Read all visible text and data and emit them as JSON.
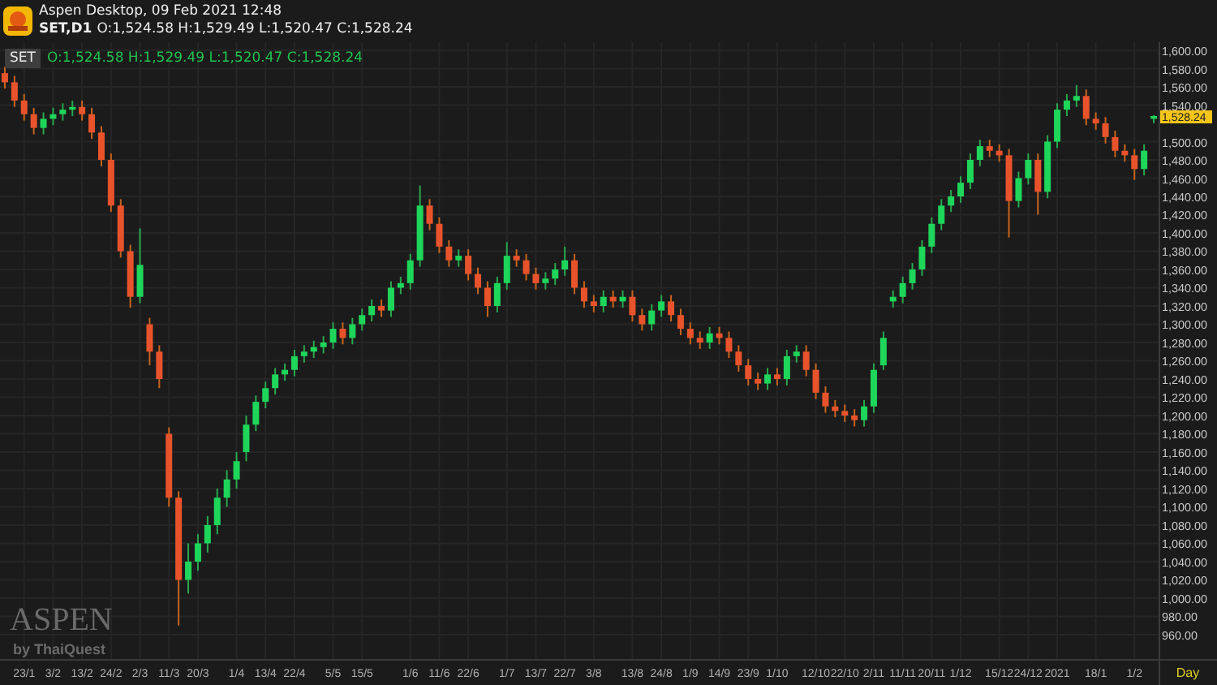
{
  "window": {
    "title": "Aspen Desktop, 09 Feb 2021 12:48",
    "symbol": "SET,D1",
    "ohlc": "O:1,524.58 H:1,529.49 L:1,520.47 C:1,528.24"
  },
  "chart": {
    "symbol_badge": "SET",
    "ohlc_legend": "O:1,524.58 H:1,529.49 L:1,520.47 C:1,528.24",
    "last_price_label": "1,528.24",
    "timeframe": "Day",
    "branding": {
      "name": "ASPEN",
      "byline": "by ThaiQuest"
    },
    "chart_data": {
      "type": "candlestick",
      "categories": [
        null,
        null,
        "23/1",
        null,
        null,
        "3/2",
        null,
        null,
        "13/2",
        null,
        null,
        "24/2",
        null,
        null,
        "2/3",
        null,
        null,
        "11/3",
        null,
        null,
        "20/3",
        null,
        null,
        null,
        "1/4",
        null,
        null,
        "13/4",
        null,
        null,
        "22/4",
        null,
        null,
        null,
        "5/5",
        null,
        null,
        "15/5",
        null,
        null,
        null,
        null,
        "1/6",
        null,
        null,
        "11/6",
        null,
        null,
        "22/6",
        null,
        null,
        null,
        "1/7",
        null,
        null,
        "13/7",
        null,
        null,
        "22/7",
        null,
        null,
        "3/8",
        null,
        null,
        null,
        "13/8",
        null,
        null,
        "24/8",
        null,
        null,
        "1/9",
        null,
        null,
        "14/9",
        null,
        null,
        "23/9",
        null,
        null,
        "1/10",
        null,
        null,
        null,
        "12/10",
        null,
        null,
        "22/10",
        null,
        null,
        "2/11",
        null,
        null,
        "11/11",
        null,
        null,
        "20/11",
        null,
        null,
        "1/12",
        null,
        null,
        null,
        "15/12",
        null,
        null,
        "24/12",
        null,
        null,
        "2021",
        null,
        null,
        null,
        "18/1",
        null,
        null,
        null,
        "1/2",
        null,
        null
      ],
      "ohlc": [
        [
          1575,
          1582,
          1558,
          1565
        ],
        [
          1565,
          1572,
          1538,
          1545
        ],
        [
          1545,
          1552,
          1523,
          1530
        ],
        [
          1530,
          1537,
          1508,
          1515
        ],
        [
          1515,
          1532,
          1508,
          1525
        ],
        [
          1525,
          1537,
          1518,
          1530
        ],
        [
          1530,
          1542,
          1523,
          1535
        ],
        [
          1535,
          1545,
          1528,
          1538
        ],
        [
          1538,
          1545,
          1523,
          1530
        ],
        [
          1530,
          1537,
          1503,
          1510
        ],
        [
          1510,
          1517,
          1473,
          1480
        ],
        [
          1480,
          1487,
          1423,
          1430
        ],
        [
          1430,
          1437,
          1373,
          1380
        ],
        [
          1380,
          1387,
          1318,
          1330
        ],
        [
          1330,
          1405,
          1323,
          1365
        ],
        [
          1300,
          1307,
          1255,
          1270
        ],
        [
          1270,
          1277,
          1230,
          1240
        ],
        [
          1180,
          1187,
          1100,
          1110
        ],
        [
          1110,
          1117,
          970,
          1020
        ],
        [
          1020,
          1060,
          1005,
          1040
        ],
        [
          1040,
          1070,
          1030,
          1060
        ],
        [
          1060,
          1090,
          1050,
          1080
        ],
        [
          1080,
          1120,
          1070,
          1110
        ],
        [
          1110,
          1140,
          1100,
          1130
        ],
        [
          1130,
          1160,
          1120,
          1150
        ],
        [
          1160,
          1200,
          1150,
          1190
        ],
        [
          1190,
          1222,
          1183,
          1215
        ],
        [
          1215,
          1237,
          1208,
          1230
        ],
        [
          1230,
          1252,
          1223,
          1245
        ],
        [
          1245,
          1257,
          1238,
          1250
        ],
        [
          1250,
          1272,
          1243,
          1265
        ],
        [
          1265,
          1277,
          1258,
          1270
        ],
        [
          1270,
          1282,
          1263,
          1275
        ],
        [
          1275,
          1287,
          1268,
          1280
        ],
        [
          1280,
          1302,
          1273,
          1295
        ],
        [
          1295,
          1302,
          1278,
          1285
        ],
        [
          1285,
          1307,
          1278,
          1300
        ],
        [
          1300,
          1317,
          1293,
          1310
        ],
        [
          1310,
          1327,
          1303,
          1320
        ],
        [
          1320,
          1327,
          1308,
          1315
        ],
        [
          1315,
          1347,
          1308,
          1340
        ],
        [
          1340,
          1352,
          1333,
          1345
        ],
        [
          1345,
          1377,
          1338,
          1370
        ],
        [
          1370,
          1452,
          1363,
          1430
        ],
        [
          1430,
          1437,
          1403,
          1410
        ],
        [
          1410,
          1417,
          1378,
          1385
        ],
        [
          1385,
          1392,
          1363,
          1370
        ],
        [
          1370,
          1382,
          1363,
          1375
        ],
        [
          1375,
          1382,
          1348,
          1355
        ],
        [
          1355,
          1362,
          1333,
          1340
        ],
        [
          1340,
          1347,
          1308,
          1320
        ],
        [
          1320,
          1352,
          1313,
          1345
        ],
        [
          1345,
          1390,
          1338,
          1375
        ],
        [
          1375,
          1382,
          1363,
          1370
        ],
        [
          1370,
          1377,
          1348,
          1355
        ],
        [
          1355,
          1362,
          1338,
          1345
        ],
        [
          1345,
          1357,
          1338,
          1350
        ],
        [
          1350,
          1367,
          1343,
          1360
        ],
        [
          1360,
          1385,
          1353,
          1370
        ],
        [
          1370,
          1377,
          1333,
          1340
        ],
        [
          1340,
          1347,
          1318,
          1325
        ],
        [
          1325,
          1332,
          1313,
          1320
        ],
        [
          1320,
          1337,
          1313,
          1330
        ],
        [
          1330,
          1337,
          1318,
          1325
        ],
        [
          1325,
          1337,
          1318,
          1330
        ],
        [
          1330,
          1337,
          1303,
          1310
        ],
        [
          1310,
          1317,
          1293,
          1300
        ],
        [
          1300,
          1322,
          1293,
          1315
        ],
        [
          1315,
          1332,
          1308,
          1325
        ],
        [
          1325,
          1332,
          1303,
          1310
        ],
        [
          1310,
          1317,
          1288,
          1295
        ],
        [
          1295,
          1302,
          1278,
          1285
        ],
        [
          1285,
          1292,
          1273,
          1280
        ],
        [
          1280,
          1297,
          1273,
          1290
        ],
        [
          1290,
          1297,
          1278,
          1285
        ],
        [
          1285,
          1292,
          1263,
          1270
        ],
        [
          1270,
          1277,
          1248,
          1255
        ],
        [
          1255,
          1262,
          1233,
          1240
        ],
        [
          1240,
          1247,
          1228,
          1235
        ],
        [
          1235,
          1252,
          1228,
          1245
        ],
        [
          1245,
          1252,
          1233,
          1240
        ],
        [
          1240,
          1272,
          1233,
          1265
        ],
        [
          1265,
          1277,
          1258,
          1270
        ],
        [
          1270,
          1277,
          1243,
          1250
        ],
        [
          1250,
          1257,
          1218,
          1225
        ],
        [
          1225,
          1232,
          1203,
          1210
        ],
        [
          1210,
          1217,
          1198,
          1205
        ],
        [
          1205,
          1212,
          1193,
          1200
        ],
        [
          1200,
          1207,
          1188,
          1195
        ],
        [
          1195,
          1217,
          1188,
          1210
        ],
        [
          1210,
          1257,
          1203,
          1250
        ],
        [
          1255,
          1292,
          1250,
          1285
        ],
        [
          1325,
          1337,
          1318,
          1330
        ],
        [
          1330,
          1352,
          1323,
          1345
        ],
        [
          1345,
          1367,
          1338,
          1360
        ],
        [
          1360,
          1392,
          1353,
          1385
        ],
        [
          1385,
          1417,
          1378,
          1410
        ],
        [
          1410,
          1437,
          1403,
          1430
        ],
        [
          1430,
          1447,
          1423,
          1440
        ],
        [
          1440,
          1462,
          1433,
          1455
        ],
        [
          1455,
          1487,
          1448,
          1480
        ],
        [
          1480,
          1502,
          1473,
          1495
        ],
        [
          1495,
          1502,
          1483,
          1490
        ],
        [
          1490,
          1497,
          1478,
          1485
        ],
        [
          1485,
          1492,
          1395,
          1435
        ],
        [
          1435,
          1467,
          1428,
          1460
        ],
        [
          1460,
          1487,
          1453,
          1480
        ],
        [
          1480,
          1487,
          1420,
          1445
        ],
        [
          1445,
          1507,
          1438,
          1500
        ],
        [
          1500,
          1542,
          1493,
          1535
        ],
        [
          1535,
          1552,
          1528,
          1545
        ],
        [
          1545,
          1562,
          1538,
          1550
        ],
        [
          1550,
          1557,
          1518,
          1525
        ],
        [
          1525,
          1532,
          1513,
          1520
        ],
        [
          1520,
          1527,
          1498,
          1505
        ],
        [
          1505,
          1512,
          1483,
          1490
        ],
        [
          1490,
          1497,
          1478,
          1485
        ],
        [
          1485,
          1492,
          1458,
          1470
        ],
        [
          1470,
          1497,
          1463,
          1490
        ],
        [
          1525,
          1529,
          1520,
          1528
        ]
      ],
      "grid": true,
      "ylim": [
        933.3,
        1608.9
      ],
      "yticks": [
        {
          "value": 1600,
          "label": "1,600.00"
        },
        {
          "value": 1580,
          "label": "1,580.00"
        },
        {
          "value": 1560,
          "label": "1,560.00"
        },
        {
          "value": 1540,
          "label": "1,540.00"
        },
        {
          "value": 1500,
          "label": "1,500.00"
        },
        {
          "value": 1480,
          "label": "1,480.00"
        },
        {
          "value": 1460,
          "label": "1,460.00"
        },
        {
          "value": 1440,
          "label": "1,440.00"
        },
        {
          "value": 1420,
          "label": "1,420.00"
        },
        {
          "value": 1400,
          "label": "1,400.00"
        },
        {
          "value": 1380,
          "label": "1,380.00"
        },
        {
          "value": 1360,
          "label": "1,360.00"
        },
        {
          "value": 1340,
          "label": "1,340.00"
        },
        {
          "value": 1320,
          "label": "1,320.00"
        },
        {
          "value": 1300,
          "label": "1,300.00"
        },
        {
          "value": 1280,
          "label": "1,280.00"
        },
        {
          "value": 1260,
          "label": "1,260.00"
        },
        {
          "value": 1240,
          "label": "1,240.00"
        },
        {
          "value": 1220,
          "label": "1,220.00"
        },
        {
          "value": 1200,
          "label": "1,200.00"
        },
        {
          "value": 1180,
          "label": "1,180.00"
        },
        {
          "value": 1160,
          "label": "1,160.00"
        },
        {
          "value": 1140,
          "label": "1,140.00"
        },
        {
          "value": 1120,
          "label": "1,120.00"
        },
        {
          "value": 1100,
          "label": "1,100.00"
        },
        {
          "value": 1080,
          "label": "1,080.00"
        },
        {
          "value": 1060,
          "label": "1,060.00"
        },
        {
          "value": 1040,
          "label": "1,040.00"
        },
        {
          "value": 1020,
          "label": "1,020.00"
        },
        {
          "value": 1000,
          "label": "1,000.00"
        },
        {
          "value": 980,
          "label": "980.00"
        },
        {
          "value": 960,
          "label": "960.00"
        }
      ]
    }
  }
}
